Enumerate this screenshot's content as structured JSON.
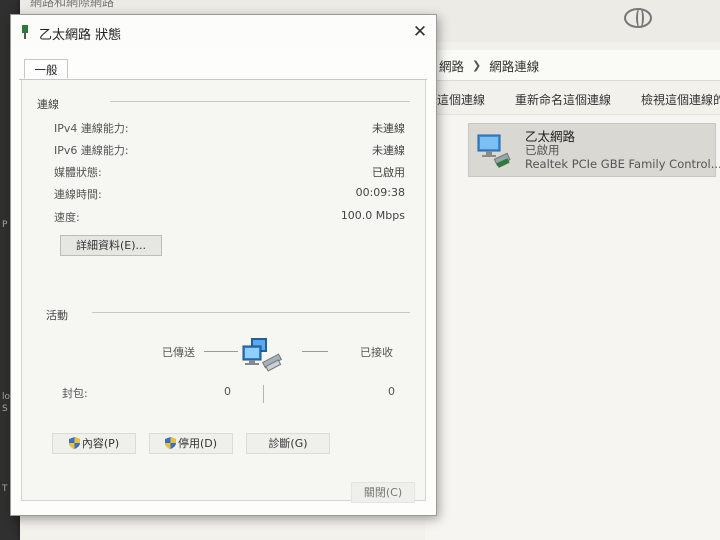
{
  "background_window": {
    "title": "網路和網際網路",
    "breadcrumb": [
      "網路",
      "網路連線"
    ],
    "toolbar": [
      "這個連線",
      "重新命名這個連線",
      "檢視這個連線的"
    ],
    "adapter": {
      "name": "乙太網路",
      "status": "已啟用",
      "device": "Realtek PCIe GBE Family Control..."
    }
  },
  "desktop_strip": [
    "P",
    "lo",
    "S",
    "T"
  ],
  "dialog": {
    "title": "乙太網路 狀態",
    "close_glyph": "✕",
    "tab": "一般",
    "connection": {
      "group_label": "連線",
      "rows": [
        {
          "label": "IPv4 連線能力:",
          "value": "未連線"
        },
        {
          "label": "IPv6 連線能力:",
          "value": "未連線"
        },
        {
          "label": "媒體狀態:",
          "value": "已啟用"
        },
        {
          "label": "連線時間:",
          "value": "00:09:38"
        },
        {
          "label": "速度:",
          "value": "100.0 Mbps"
        }
      ],
      "details_button": "詳細資料(E)..."
    },
    "activity": {
      "group_label": "活動",
      "sent_label": "已傳送",
      "received_label": "已接收",
      "packets_label": "封包:",
      "packets_sent": "0",
      "packets_received": "0"
    },
    "buttons": {
      "properties": "內容(P)",
      "disable": "停用(D)",
      "diagnose": "診斷(G)",
      "close": "關閉(C)"
    }
  },
  "colors": {
    "dialog_bg": "#fdfdfb",
    "panel_bg": "#f6f6f3",
    "adapter_selected": "#d9d8d3",
    "monitor_blue": "#3b8fd9"
  }
}
